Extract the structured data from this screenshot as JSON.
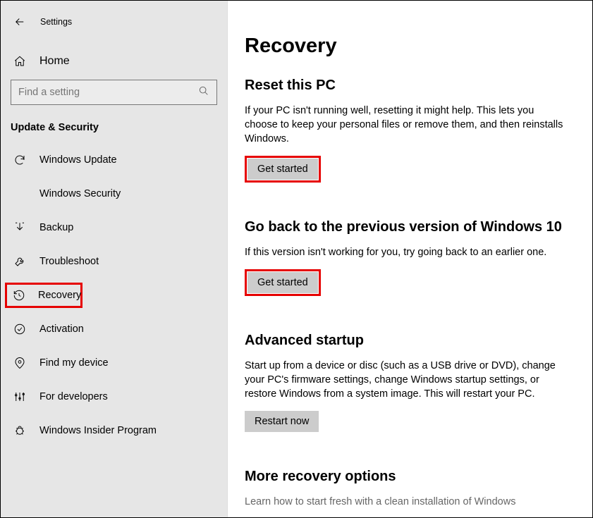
{
  "header": {
    "title": "Settings"
  },
  "home_label": "Home",
  "search": {
    "placeholder": "Find a setting"
  },
  "category": "Update & Security",
  "nav": {
    "windows_update": "Windows Update",
    "windows_security": "Windows Security",
    "backup": "Backup",
    "troubleshoot": "Troubleshoot",
    "recovery": "Recovery",
    "activation": "Activation",
    "find_my_device": "Find my device",
    "for_developers": "For developers",
    "windows_insider": "Windows Insider Program"
  },
  "main": {
    "title": "Recovery",
    "reset": {
      "heading": "Reset this PC",
      "body": "If your PC isn't running well, resetting it might help. This lets you choose to keep your personal files or remove them, and then reinstalls Windows.",
      "button": "Get started"
    },
    "goback": {
      "heading": "Go back to the previous version of Windows 10",
      "body": "If this version isn't working for you, try going back to an earlier one.",
      "button": "Get started"
    },
    "advanced": {
      "heading": "Advanced startup",
      "body": "Start up from a device or disc (such as a USB drive or DVD), change your PC's firmware settings, change Windows startup settings, or restore Windows from a system image. This will restart your PC.",
      "button": "Restart now"
    },
    "more": {
      "heading": "More recovery options",
      "body": "Learn how to start fresh with a clean installation of Windows"
    }
  }
}
